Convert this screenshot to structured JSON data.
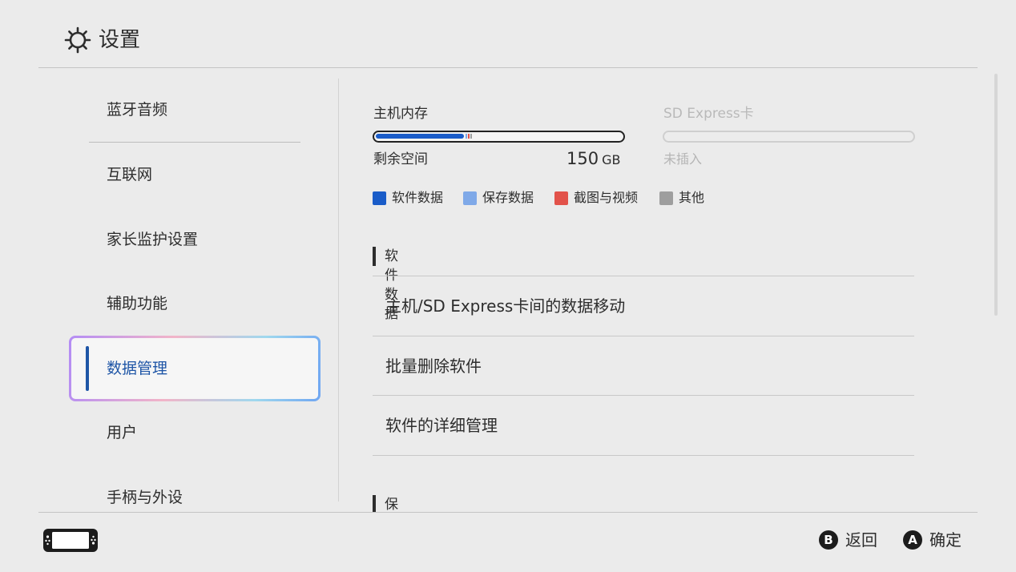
{
  "header": {
    "title": "设置",
    "icon": "gear-icon"
  },
  "sidebar": {
    "items": [
      {
        "label": "蓝牙音频",
        "selected": false
      },
      {
        "label": "互联网",
        "selected": false
      },
      {
        "label": "家长监护设置",
        "selected": false
      },
      {
        "label": "辅助功能",
        "selected": false
      },
      {
        "label": "数据管理",
        "selected": true
      },
      {
        "label": "用户",
        "selected": false
      },
      {
        "label": "手柄与外设",
        "selected": false
      }
    ]
  },
  "storage": {
    "internal": {
      "title": "主机内存",
      "remaining_label": "剩余空间",
      "remaining_value": "150",
      "remaining_unit": "GB",
      "used_fraction": 0.36
    },
    "sd": {
      "title": "SD Express卡",
      "status": "未插入"
    },
    "legend": [
      {
        "label": "软件数据",
        "color": "#1a5cc8"
      },
      {
        "label": "保存数据",
        "color": "#7fa9e8"
      },
      {
        "label": "截图与视频",
        "color": "#e2524a"
      },
      {
        "label": "其他",
        "color": "#9e9e9e"
      }
    ]
  },
  "sections": {
    "software": {
      "title": "软件数据",
      "items": [
        {
          "label": "主机/SD Express卡间的数据移动"
        },
        {
          "label": "批量删除软件"
        },
        {
          "label": "软件的详细管理"
        }
      ]
    },
    "save": {
      "title": "保存数据"
    }
  },
  "footer": {
    "back": {
      "key": "B",
      "label": "返回"
    },
    "confirm": {
      "key": "A",
      "label": "确定"
    }
  },
  "colors": {
    "accent": "#1e55a6",
    "background": "#ebebeb"
  }
}
